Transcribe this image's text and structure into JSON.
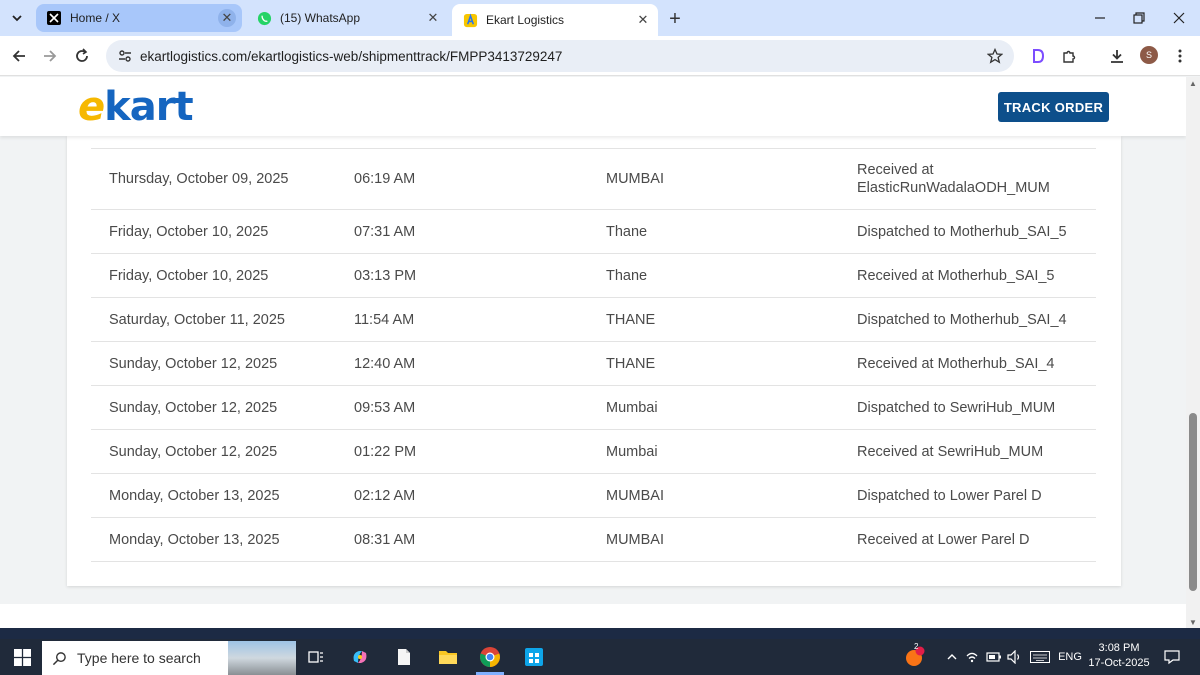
{
  "browser": {
    "tabs": [
      {
        "title": "Home / X",
        "icon": "x-logo-icon"
      },
      {
        "title": "(15) WhatsApp",
        "icon": "whatsapp-icon"
      },
      {
        "title": "Ekart Logistics",
        "icon": "flipkart-icon"
      }
    ],
    "active_tab": 2,
    "url": "ekartlogistics.com/ekartlogistics-web/shipmenttrack/FMPP3413729247",
    "profile_initial": "S"
  },
  "site": {
    "logo_e": "e",
    "logo_rest": "kart",
    "track_button": "TRACK ORDER",
    "brand_color": "#0d4f8b"
  },
  "tracking": {
    "rows": [
      {
        "date": "Thursday, October 09, 2025",
        "time": "06:19 AM",
        "location": "MUMBAI",
        "status": "Received at ElasticRunWadalaODH_MUM"
      },
      {
        "date": "Friday, October 10, 2025",
        "time": "07:31 AM",
        "location": "Thane",
        "status": "Dispatched to Motherhub_SAI_5"
      },
      {
        "date": "Friday, October 10, 2025",
        "time": "03:13 PM",
        "location": "Thane",
        "status": "Received at Motherhub_SAI_5"
      },
      {
        "date": "Saturday, October 11, 2025",
        "time": "11:54 AM",
        "location": "THANE",
        "status": "Dispatched to Motherhub_SAI_4"
      },
      {
        "date": "Sunday, October 12, 2025",
        "time": "12:40 AM",
        "location": "THANE",
        "status": "Received at Motherhub_SAI_4"
      },
      {
        "date": "Sunday, October 12, 2025",
        "time": "09:53 AM",
        "location": "Mumbai",
        "status": "Dispatched to SewriHub_MUM"
      },
      {
        "date": "Sunday, October 12, 2025",
        "time": "01:22 PM",
        "location": "Mumbai",
        "status": "Received at SewriHub_MUM"
      },
      {
        "date": "Monday, October 13, 2025",
        "time": "02:12 AM",
        "location": "MUMBAI",
        "status": "Dispatched to Lower Parel D"
      },
      {
        "date": "Monday, October 13, 2025",
        "time": "08:31 AM",
        "location": "MUMBAI",
        "status": "Received at Lower Parel D"
      }
    ]
  },
  "taskbar": {
    "search_placeholder": "Type here to search",
    "notification_count": "2",
    "language": "ENG",
    "time": "3:08 PM",
    "date": "17-Oct-2025"
  }
}
